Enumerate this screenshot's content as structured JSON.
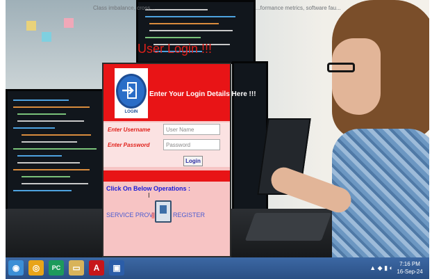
{
  "top_caption_left": "Class imbalance, cross...",
  "top_caption_right": "...formance metrics, software fau...",
  "page_heading": "User Login !!!",
  "login_panel": {
    "logo_text": "LOGIN",
    "header_text": "Enter Your Login Details Here !!!",
    "username_label": "Enter Username",
    "username_placeholder": "User Name",
    "password_label": "Enter Password",
    "password_placeholder": "Password",
    "login_button": "Login",
    "operations_title": "Click On Below Operations :",
    "service_provider_link": "SERVICE PROVIDER",
    "separator": "||",
    "register_link": "REGISTER"
  },
  "taskbar": {
    "apps": [
      {
        "name": "start-orb-icon",
        "glyph": "◉",
        "color": "#3b8fd6"
      },
      {
        "name": "chrome-icon",
        "glyph": "◎",
        "color": "#e8a419"
      },
      {
        "name": "pycharm-icon",
        "glyph": "PC",
        "color": "#1d9a5b"
      },
      {
        "name": "folder-icon",
        "glyph": "▭",
        "color": "#d8b35a"
      },
      {
        "name": "pdf-icon",
        "glyph": "A",
        "color": "#c7161a"
      },
      {
        "name": "app-window-icon",
        "glyph": "▣",
        "color": "#2b5da8"
      }
    ],
    "clock_time": "7:16 PM",
    "clock_date": "16-Sep-24"
  },
  "colors": {
    "accent_red": "#e81416",
    "panel_pink": "#f7c4c4",
    "link_blue": "#4b5bd0"
  }
}
